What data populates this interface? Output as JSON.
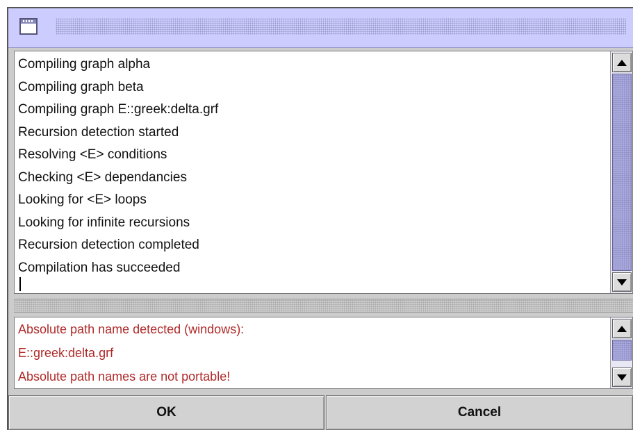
{
  "window": {
    "icon": "window-icon"
  },
  "log": {
    "lines": [
      "Compiling graph alpha",
      "Compiling graph beta",
      "Compiling graph E::greek:delta.grf",
      "Recursion detection started",
      "Resolving <E> conditions",
      "Checking <E> dependancies",
      "Looking for <E> loops",
      "Looking for infinite recursions",
      "Recursion detection completed",
      "Compilation has succeeded"
    ]
  },
  "errors": {
    "lines": [
      "Absolute path name detected (windows):",
      "E::greek:delta.grf",
      "Absolute path names are not portable!"
    ],
    "color": "#b02a2a"
  },
  "buttons": {
    "ok": "OK",
    "cancel": "Cancel"
  },
  "colors": {
    "titlebar": "#ccccff",
    "scroll_thumb": "#aaaadd",
    "dialog_bg": "#cccccc"
  }
}
